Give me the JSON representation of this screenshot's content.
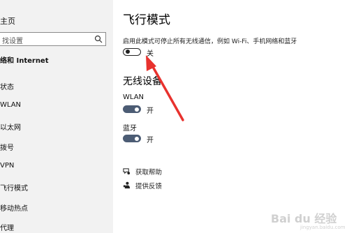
{
  "sidebar": {
    "home_label": "主页",
    "search_placeholder": "找设置",
    "section_label": "络和 Internet",
    "items": [
      {
        "label": "状态"
      },
      {
        "label": "WLAN"
      },
      {
        "label": "以太网"
      },
      {
        "label": "拨号"
      },
      {
        "label": "VPN"
      },
      {
        "label": "飞行模式"
      },
      {
        "label": "移动热点"
      },
      {
        "label": "代理"
      }
    ]
  },
  "main": {
    "title": "飞行模式",
    "description": "启用此模式可停止所有无线通信，例如 Wi-Fi、手机网络和蓝牙",
    "airplane_toggle": {
      "state": "关",
      "on": false
    },
    "wireless_section_title": "无线设备",
    "devices": [
      {
        "label": "WLAN",
        "state": "开",
        "on": true
      },
      {
        "label": "蓝牙",
        "state": "开",
        "on": true
      }
    ],
    "links": [
      {
        "label": "获取帮助",
        "icon": "help-chat-icon"
      },
      {
        "label": "提供反馈",
        "icon": "feedback-person-icon"
      }
    ]
  },
  "annotation": {
    "color": "#e8322e"
  },
  "watermark": {
    "text": "Bai du 经验",
    "sub": "jingyan.baidu.com"
  }
}
